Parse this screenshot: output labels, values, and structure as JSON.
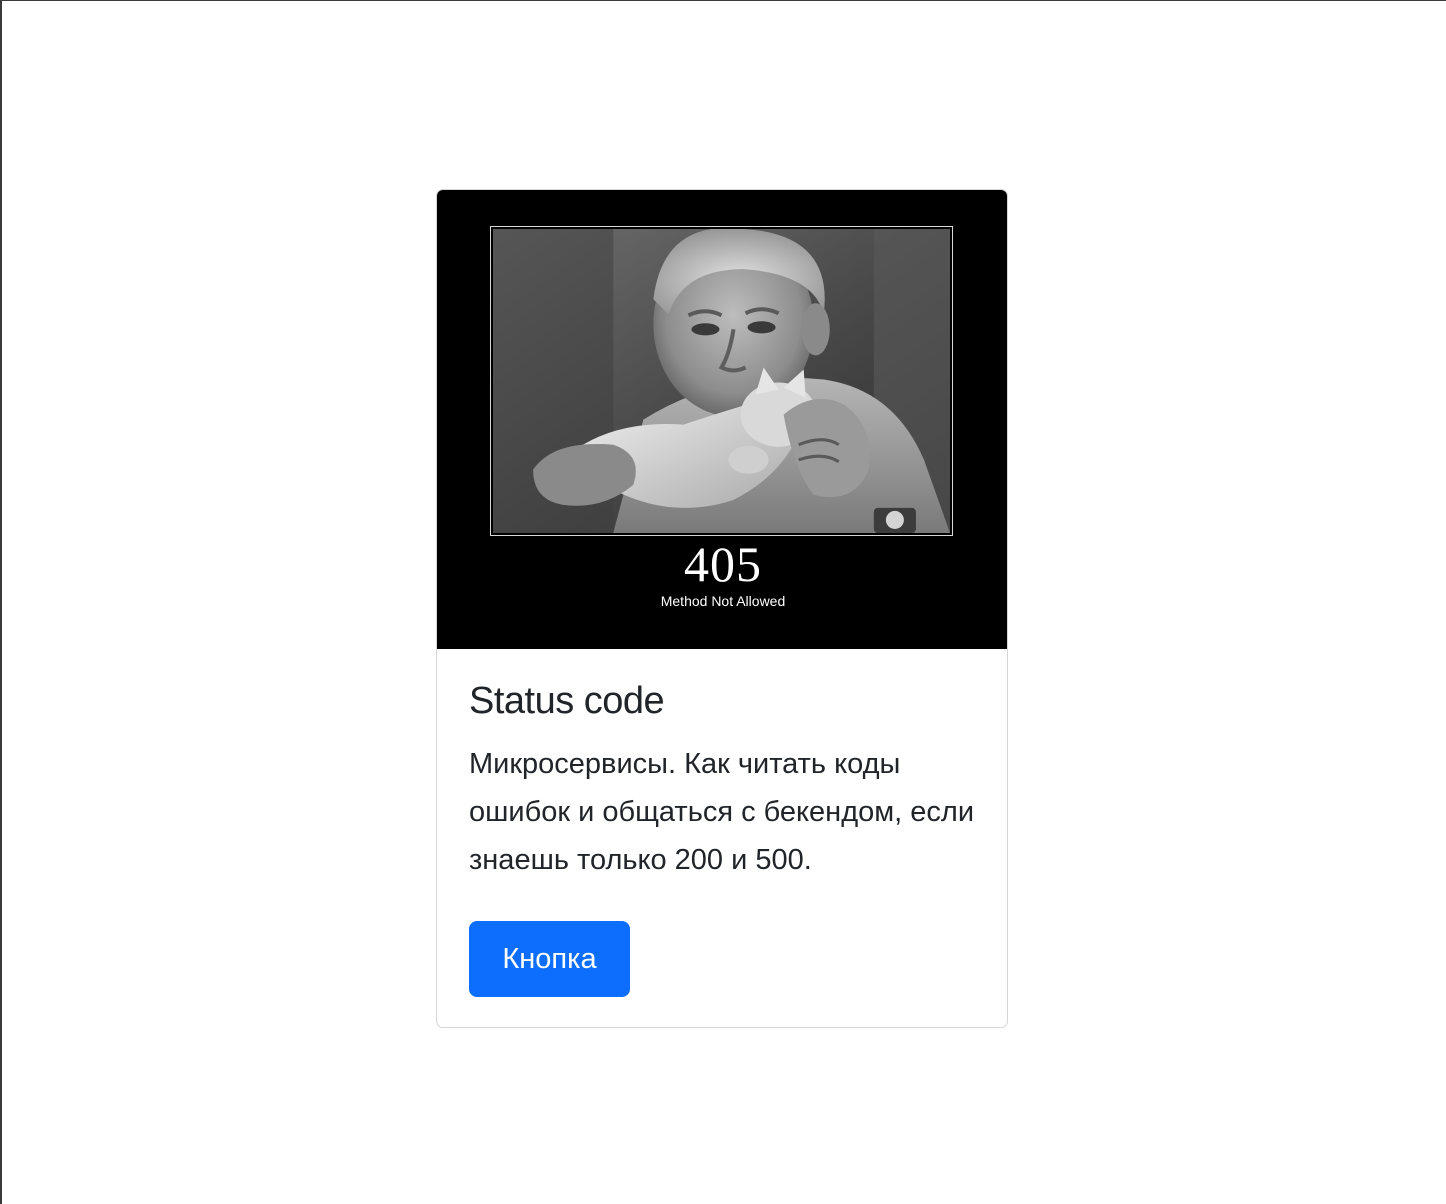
{
  "card": {
    "image": {
      "code": "405",
      "caption": "Method Not Allowed"
    },
    "title": "Status code",
    "text": "Микросервисы. Как читать коды ошибок и общаться с бекендом, если знаешь только 200 и 500.",
    "button_label": "Кнопка"
  },
  "colors": {
    "accent": "#0d6efd",
    "text": "#212529",
    "card_border": "#d3d5d8",
    "image_background": "#000000"
  }
}
